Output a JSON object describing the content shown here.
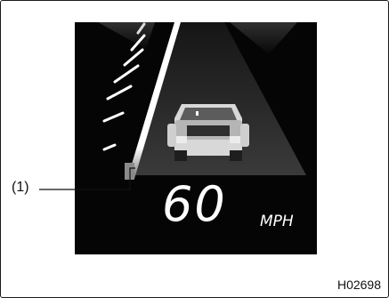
{
  "display": {
    "speed_value": "60",
    "speed_unit": "MPH",
    "indicator_segments": 7,
    "indicator_segments_lit": 5,
    "car_icon": "car-rear-icon"
  },
  "callout": {
    "label": "(1)"
  },
  "figure": {
    "code": "H02698"
  },
  "colors": {
    "display_background": "#050505",
    "indicator_white": "#ffffff",
    "lane_gray": "#2b2b2b"
  }
}
